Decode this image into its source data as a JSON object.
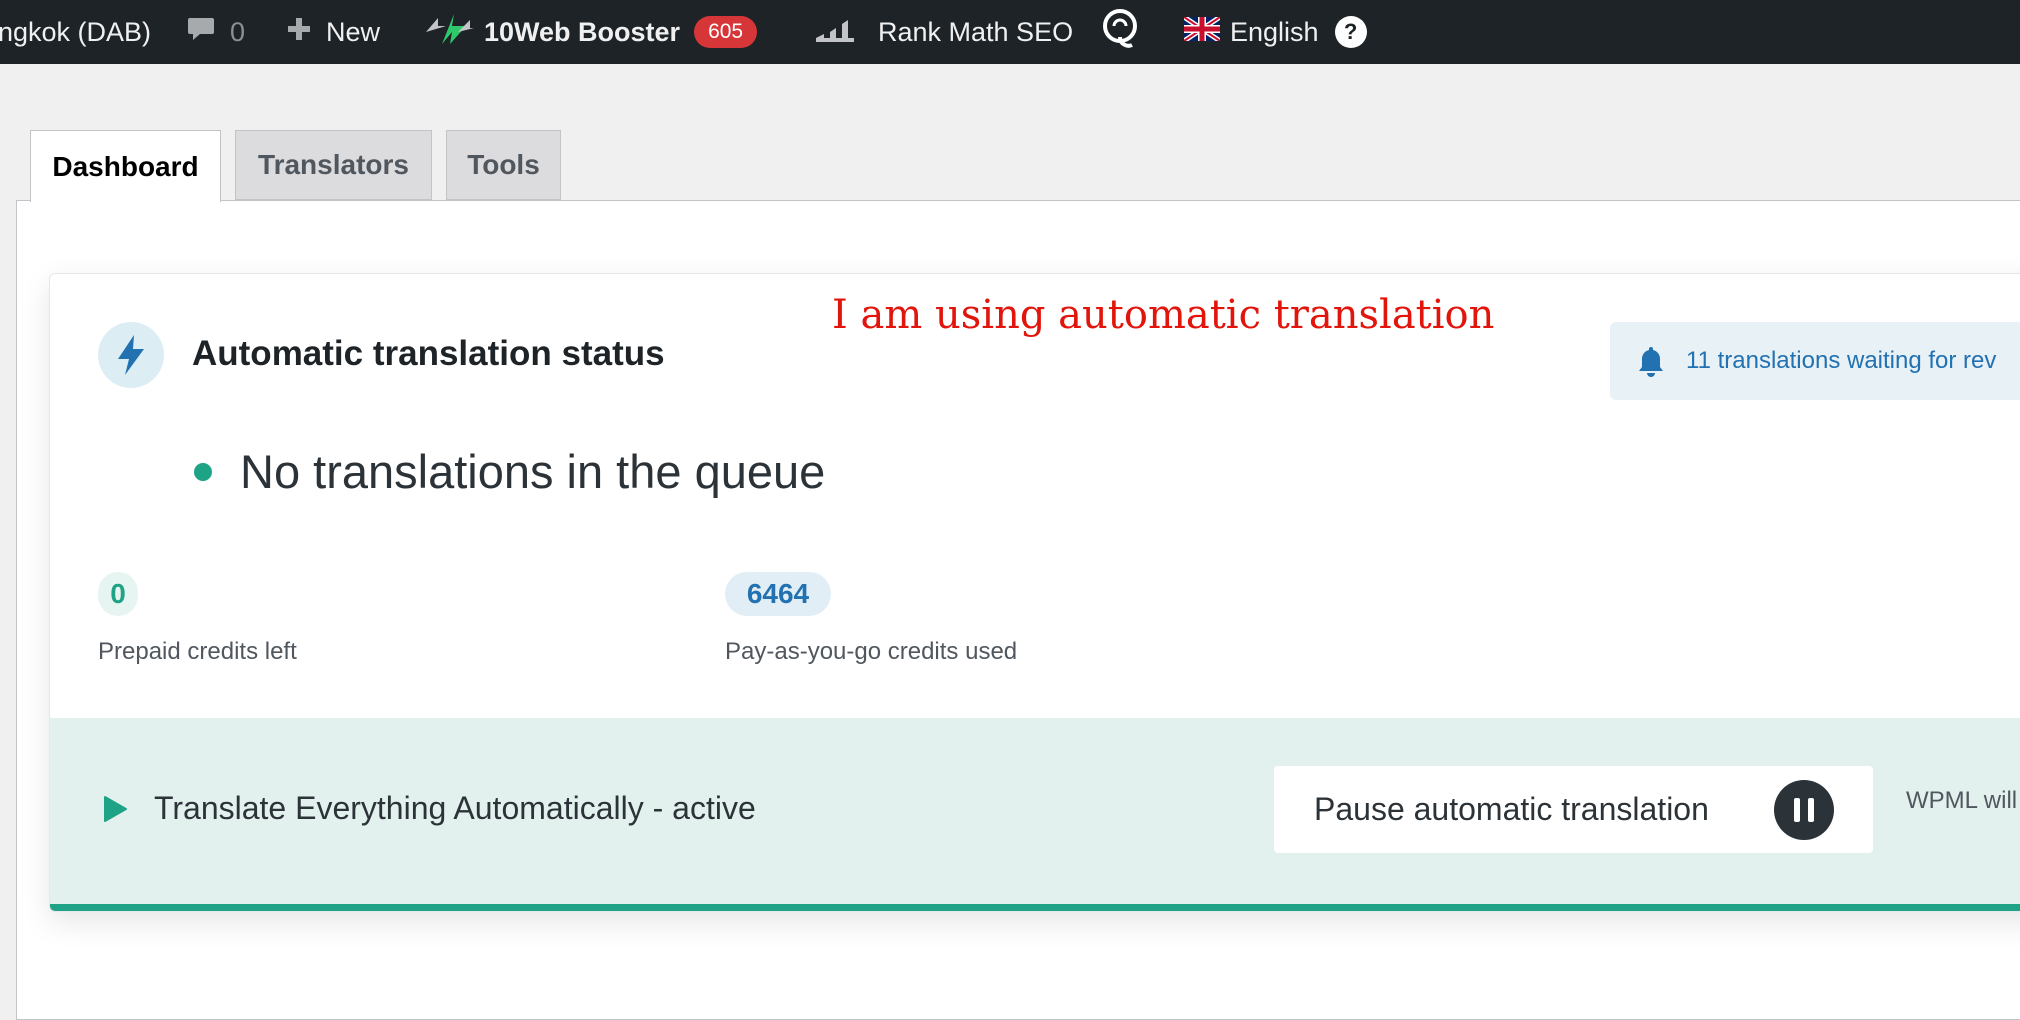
{
  "admin_bar": {
    "site_name": "ngkok (DAB)",
    "comments_count": "0",
    "new_label": "New",
    "booster_label": "10Web Booster",
    "booster_badge": "605",
    "rank_math_label": "Rank Math SEO",
    "language_label": "English",
    "help_label": "?"
  },
  "tabs": [
    {
      "label": "Dashboard",
      "active": true
    },
    {
      "label": "Translators",
      "active": false
    },
    {
      "label": "Tools",
      "active": false
    }
  ],
  "status": {
    "title": "Automatic translation status",
    "annotation": "I am using automatic translation",
    "review_notice": "11 translations waiting for rev",
    "queue_text": "No translations in the queue",
    "prepaid_credits": "0",
    "prepaid_label": "Prepaid credits left",
    "payg_credits": "6464",
    "payg_label": "Pay-as-you-go credits used"
  },
  "footer": {
    "mode_text": "Translate Everything Automatically - active",
    "pause_button": "Pause automatic translation",
    "wpml_note": "WPML will"
  },
  "colors": {
    "admin_bar_bg": "#1d2327",
    "accent_green": "#1fa387",
    "accent_blue": "#2271b1",
    "badge_red": "#d63638",
    "annotation_red": "#e2150c"
  },
  "icons": [
    "comment-icon",
    "plus-icon",
    "booster-bolt-icon",
    "rank-math-icon",
    "q-logo-icon",
    "uk-flag-icon",
    "help-icon",
    "bolt-icon",
    "bell-icon",
    "play-icon",
    "pause-icon"
  ]
}
